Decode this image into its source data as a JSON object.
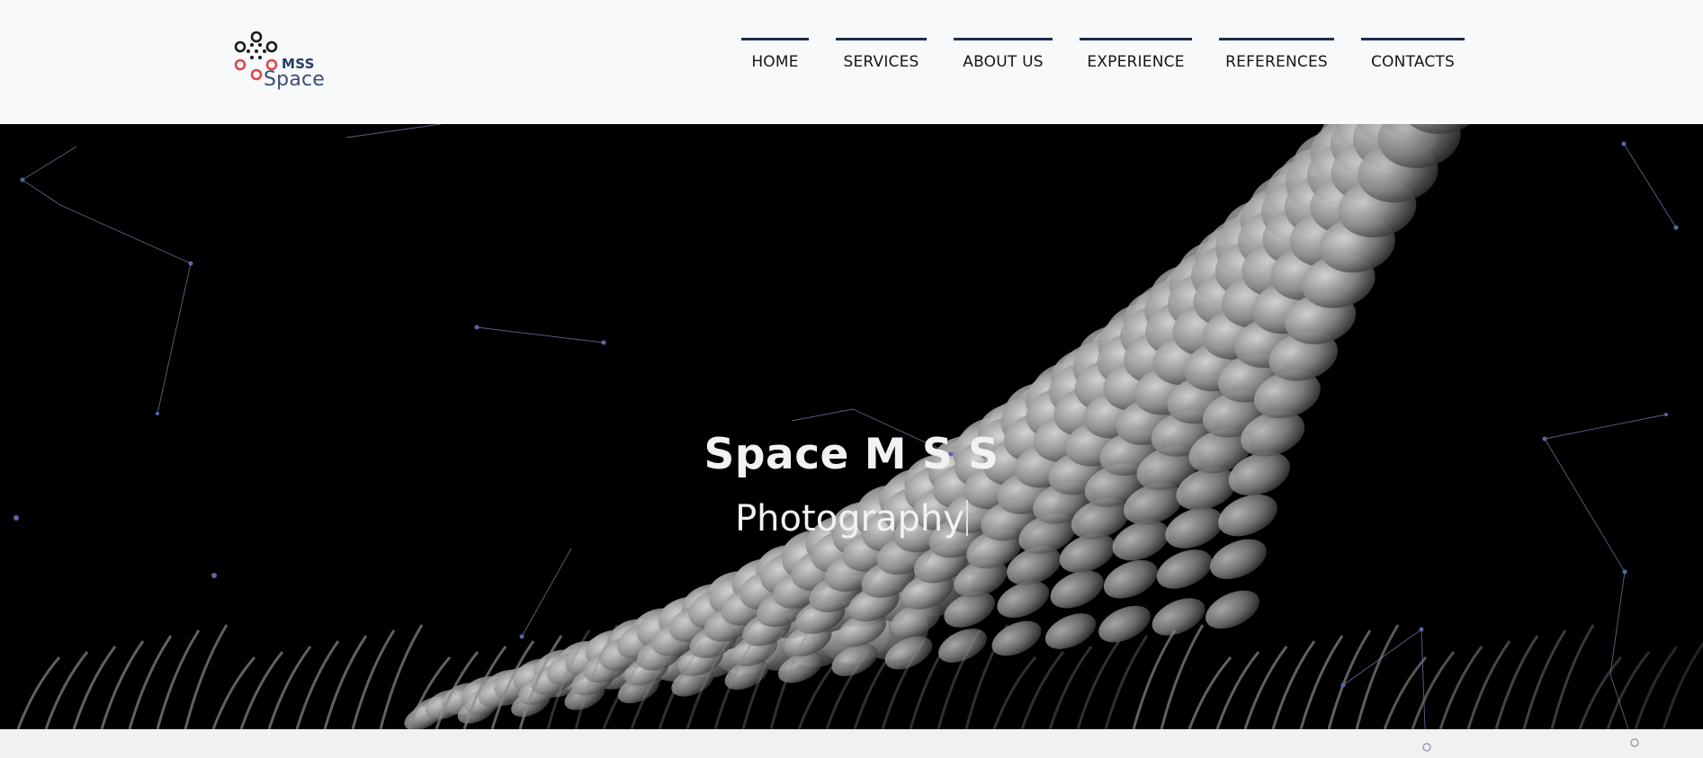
{
  "brand": {
    "mark": "MSS",
    "name": "Space"
  },
  "nav": {
    "items": [
      {
        "label": "HOME"
      },
      {
        "label": "SERVICES"
      },
      {
        "label": "ABOUT US"
      },
      {
        "label": "EXPERIENCE"
      },
      {
        "label": "REFERENCES"
      },
      {
        "label": "CONTACTS"
      }
    ]
  },
  "hero": {
    "title": "Space M S S",
    "subtitle": "Photography"
  },
  "colors": {
    "nav_accent": "#1e2d50",
    "logo_red": "#e0474c",
    "logo_dark": "#1a1a1a",
    "logo_text": "#283a63",
    "hero_bg": "#000000"
  }
}
